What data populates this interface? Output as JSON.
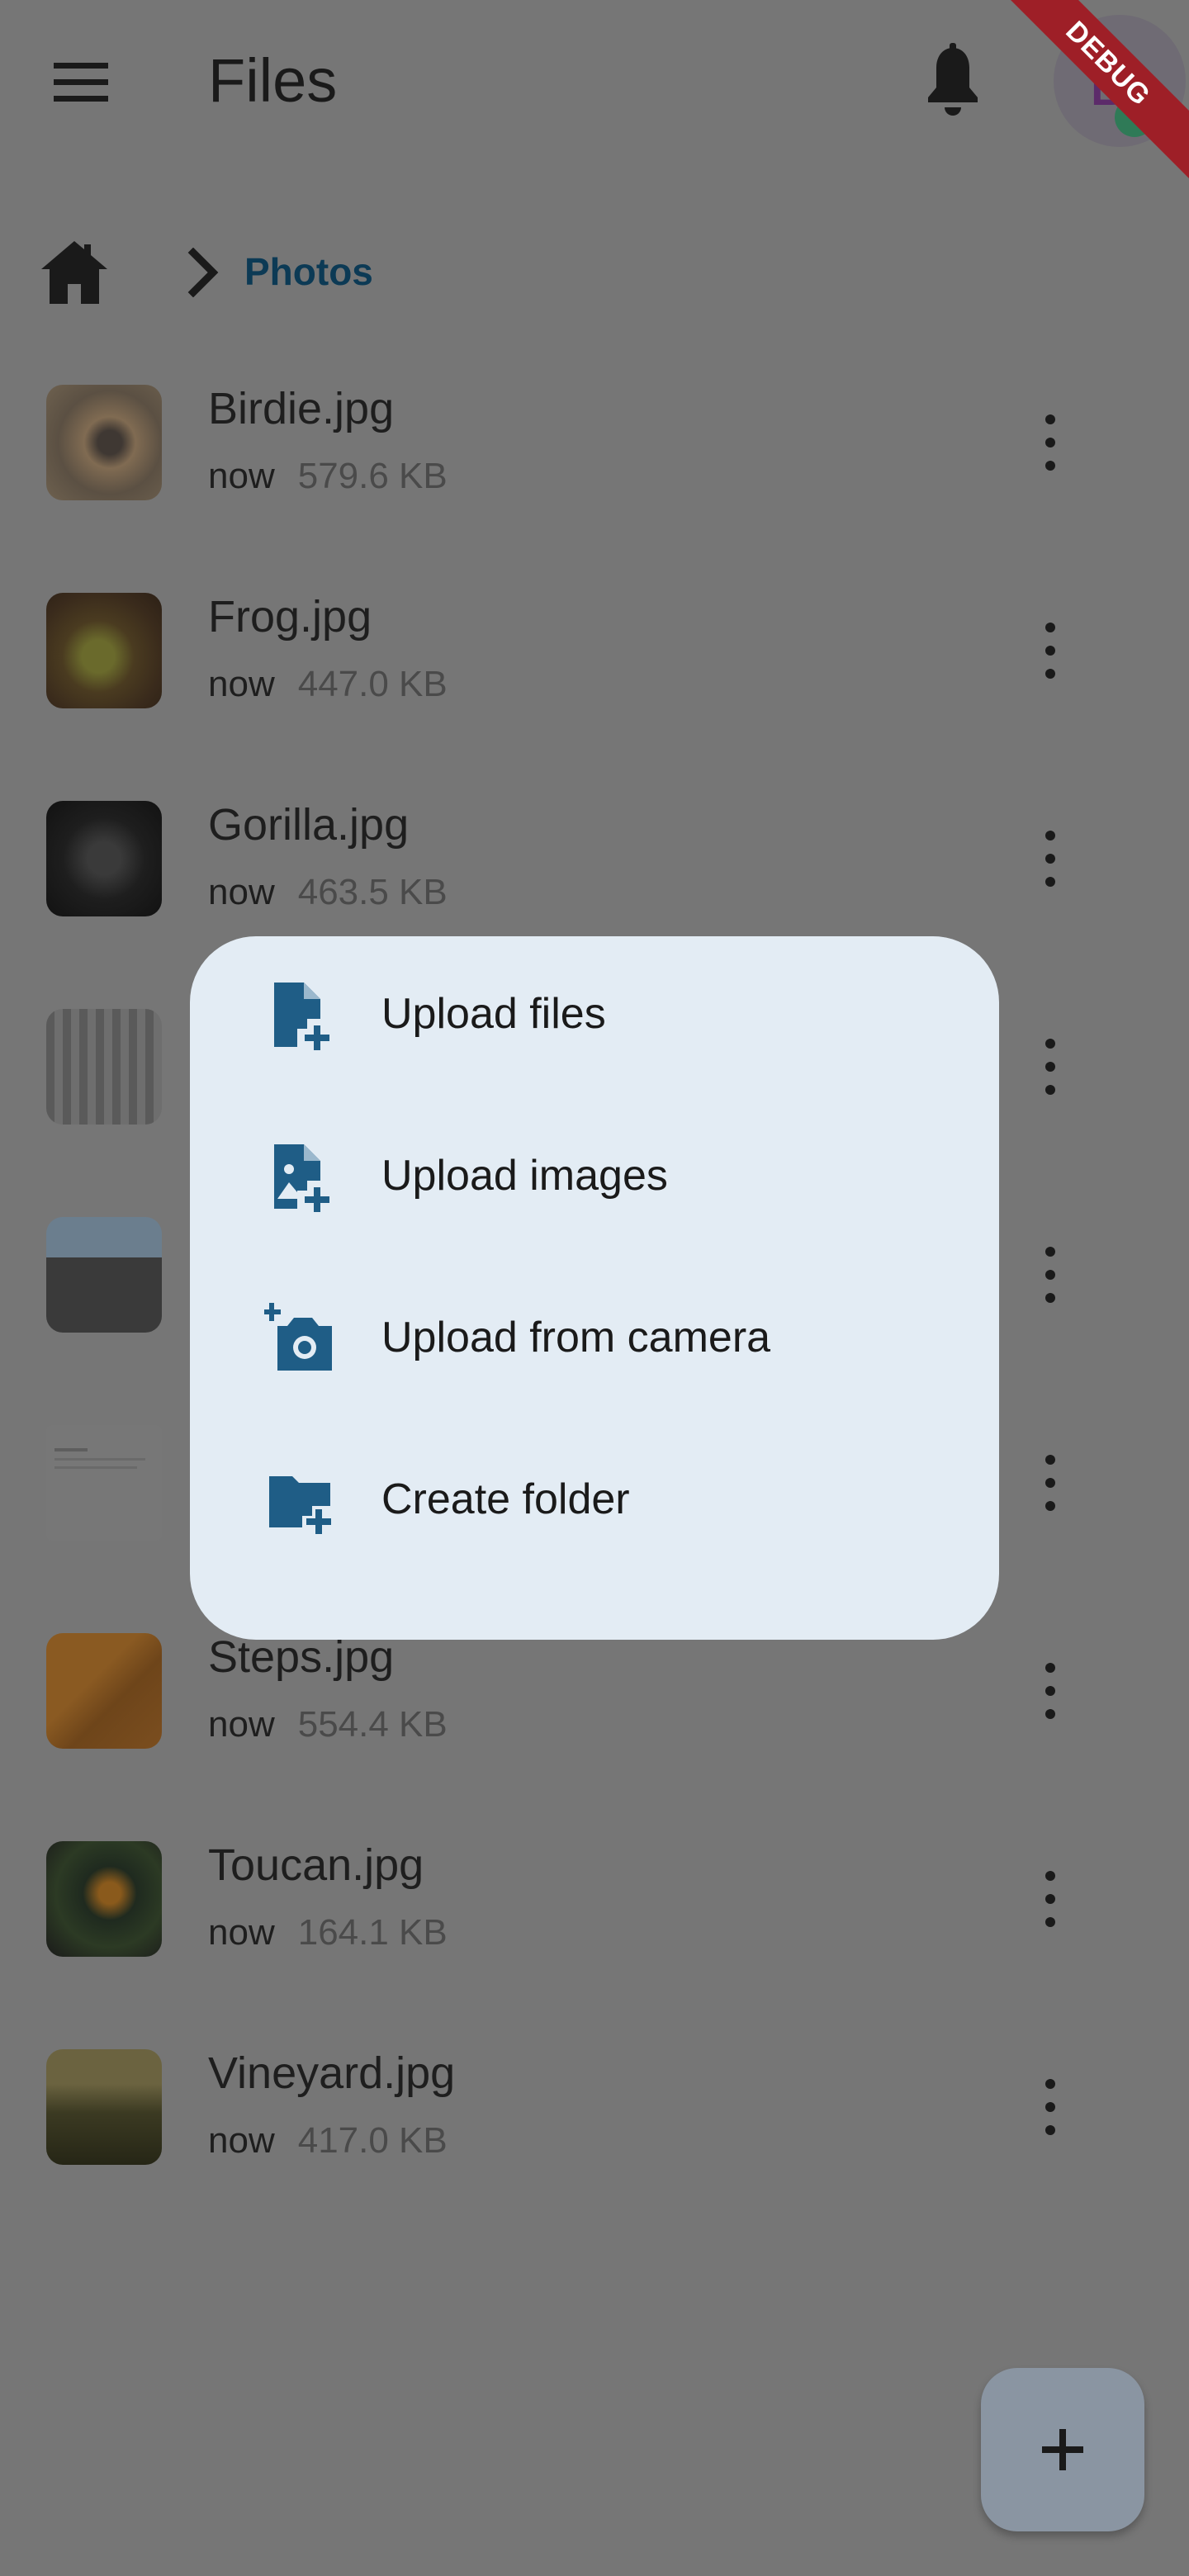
{
  "appbar": {
    "title": "Files",
    "avatar_letter": "D",
    "debug_banner": "DEBUG"
  },
  "breadcrumb": {
    "current": "Photos"
  },
  "files": [
    {
      "name": "Birdie.jpg",
      "modified": "now",
      "size": "579.6 KB"
    },
    {
      "name": "Frog.jpg",
      "modified": "now",
      "size": "447.0 KB"
    },
    {
      "name": "Gorilla.jpg",
      "modified": "now",
      "size": "463.5 KB"
    },
    {
      "name": "",
      "modified": "",
      "size": ""
    },
    {
      "name": "",
      "modified": "",
      "size": ""
    },
    {
      "name": "",
      "modified": "",
      "size": ""
    },
    {
      "name": "Steps.jpg",
      "modified": "now",
      "size": "554.4 KB"
    },
    {
      "name": "Toucan.jpg",
      "modified": "now",
      "size": "164.1 KB"
    },
    {
      "name": "Vineyard.jpg",
      "modified": "now",
      "size": "417.0 KB"
    }
  ],
  "popup_menu": {
    "items": [
      {
        "label": "Upload files",
        "icon": "upload-file-icon"
      },
      {
        "label": "Upload images",
        "icon": "upload-image-icon"
      },
      {
        "label": "Upload from camera",
        "icon": "camera-add-icon"
      },
      {
        "label": "Create folder",
        "icon": "folder-add-icon"
      }
    ]
  },
  "colors": {
    "scrim": "#767676",
    "popup_bg": "#e3ecf4",
    "accent": "#1f5d86",
    "debug_ribbon": "#9e1f27"
  }
}
